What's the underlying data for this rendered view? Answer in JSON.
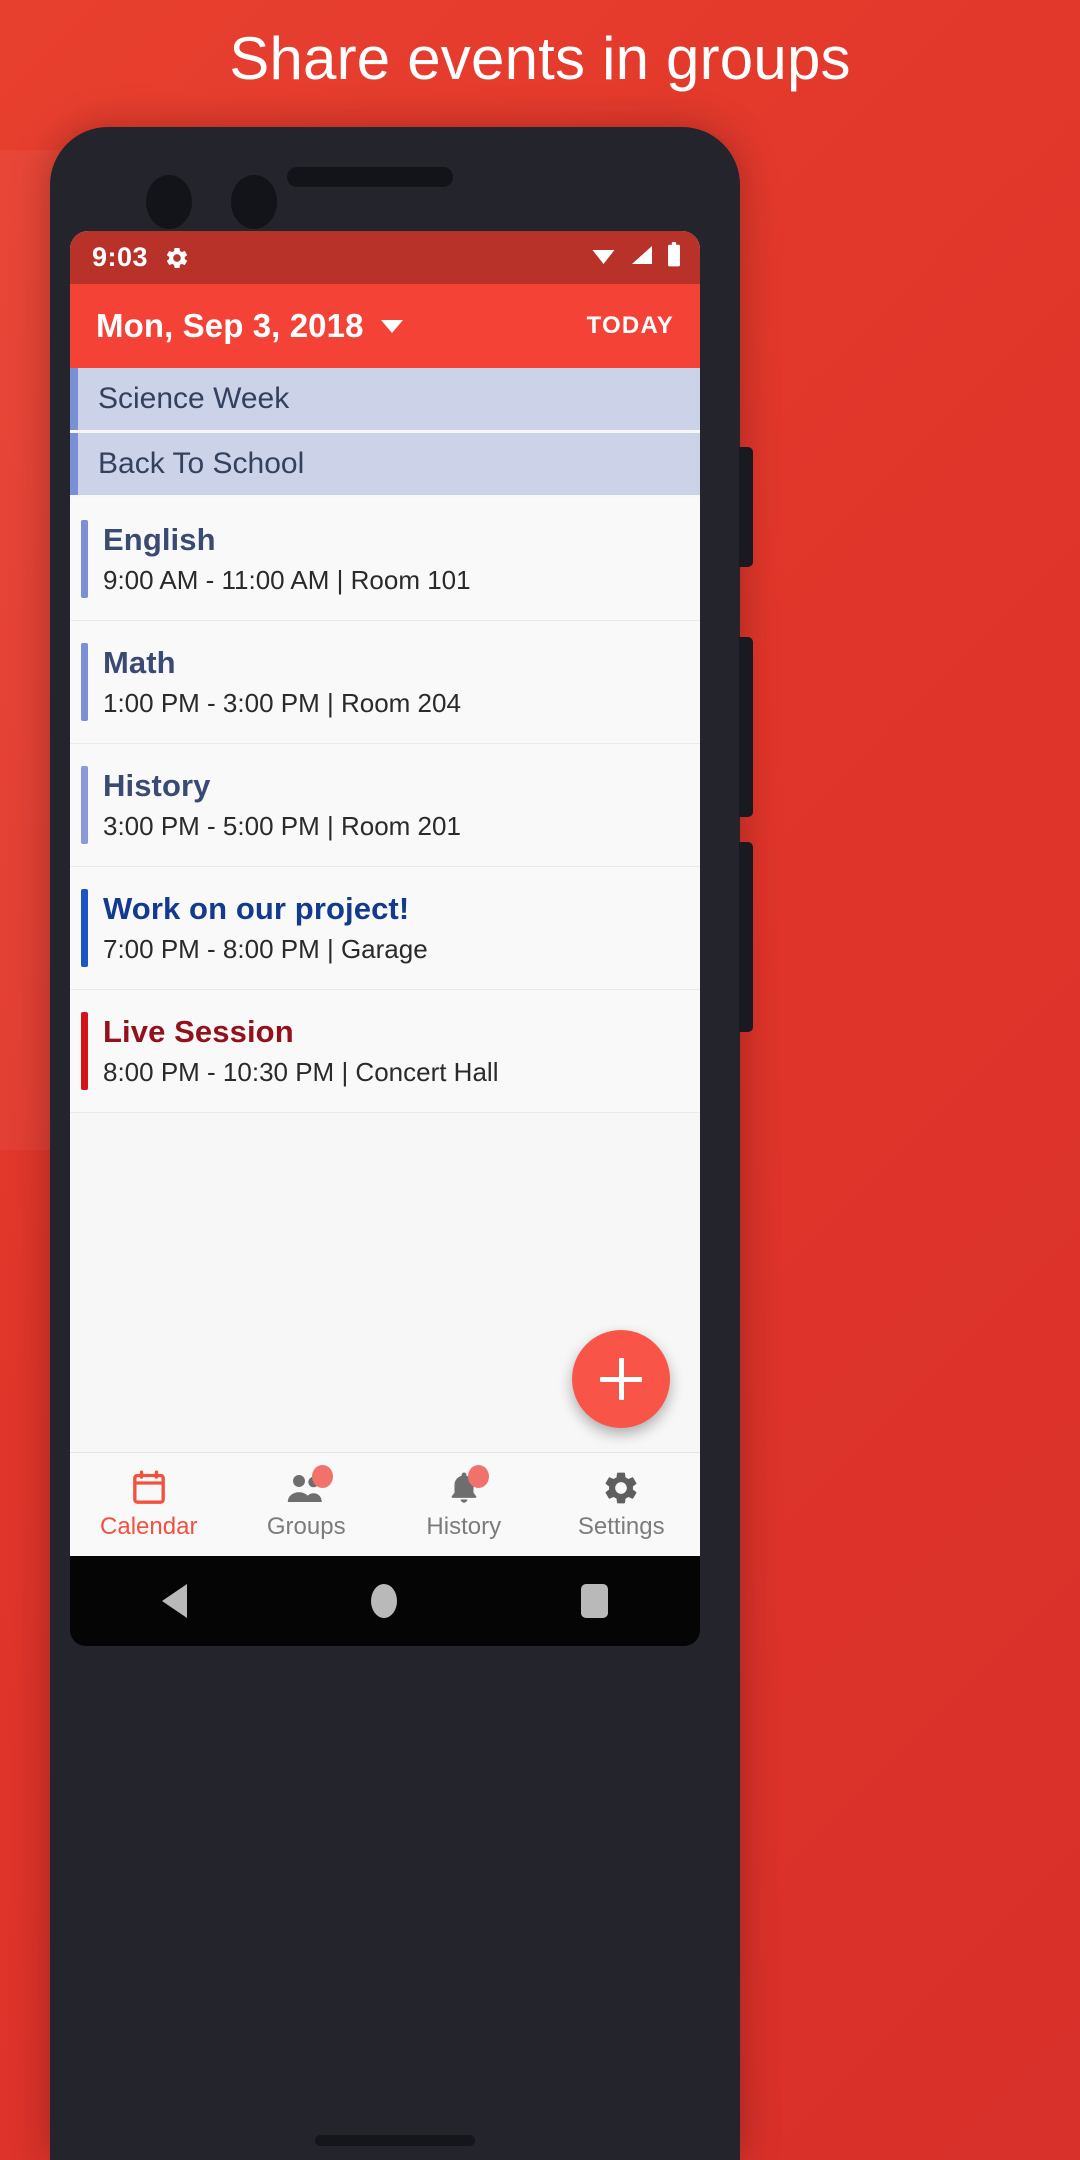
{
  "promo": {
    "title": "Share events in groups"
  },
  "status_bar": {
    "time": "9:03",
    "icons": [
      "gear-icon",
      "wifi-icon",
      "cellular-signal-icon",
      "battery-icon"
    ]
  },
  "app_bar": {
    "date": "Mon, Sep 3, 2018",
    "dropdown_icon": "chevron-down-icon",
    "today_label": "TODAY"
  },
  "colors": {
    "brand_red": "#f44336",
    "status_red": "#b8322a",
    "promo_red": "#e0352a",
    "allday_bg": "#ccd3e8",
    "allday_bar": "#7b8fd4",
    "allday_text": "#33415f",
    "nav_active": "#f4503f",
    "nav_inactive": "#7c7c7c",
    "fab": "#f85548"
  },
  "all_day_events": [
    {
      "title": "Science Week",
      "bar_color": "#7b8fd4"
    },
    {
      "title": "Back To School",
      "bar_color": "#7b8fd4"
    }
  ],
  "events": [
    {
      "title": "English",
      "meta": "9:00 AM - 11:00 AM | Room 101",
      "bar_color": "#7b8fd4",
      "title_color": "#3b4a73"
    },
    {
      "title": "Math",
      "meta": "1:00 PM - 3:00 PM | Room 204",
      "bar_color": "#7b8fd4",
      "title_color": "#3b4a73"
    },
    {
      "title": "History",
      "meta": "3:00 PM - 5:00 PM | Room 201",
      "bar_color": "#8a9ad8",
      "title_color": "#3b4a73"
    },
    {
      "title": "Work on our project!",
      "meta": "7:00 PM - 8:00 PM | Garage",
      "bar_color": "#1a56c4",
      "title_color": "#143a8f"
    },
    {
      "title": "Live Session",
      "meta": "8:00 PM - 10:30 PM | Concert Hall",
      "bar_color": "#d5131a",
      "title_color": "#93111a"
    }
  ],
  "fab": {
    "icon": "plus-icon"
  },
  "bottom_nav": {
    "items": [
      {
        "label": "Calendar",
        "icon": "calendar-icon",
        "active": true,
        "badge": false
      },
      {
        "label": "Groups",
        "icon": "people-icon",
        "active": false,
        "badge": true
      },
      {
        "label": "History",
        "icon": "bell-icon",
        "active": false,
        "badge": true
      },
      {
        "label": "Settings",
        "icon": "gear-icon",
        "active": false,
        "badge": false
      }
    ]
  },
  "android_nav": {
    "back": "back-triangle-icon",
    "home": "home-circle-icon",
    "recents": "recents-square-icon"
  }
}
